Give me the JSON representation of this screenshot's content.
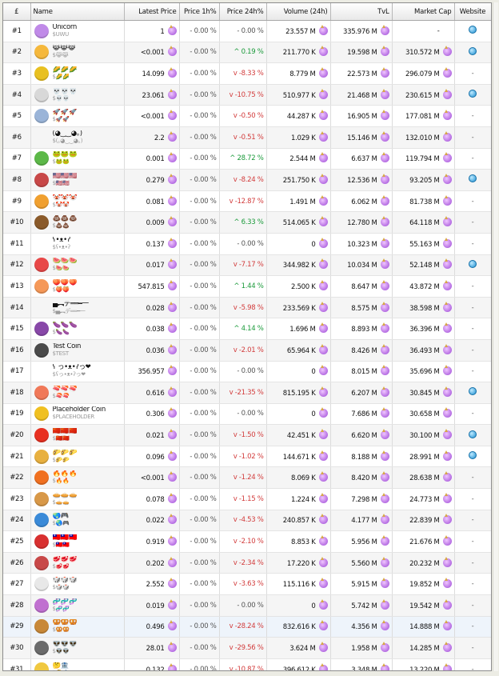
{
  "columns": [
    "£",
    "Name",
    "Latest Price",
    "Price 1h%",
    "Price 24h%",
    "Volume (24h)",
    "TvL",
    "Market Cap",
    "Website"
  ],
  "rows": [
    {
      "rank": "#1",
      "name": "Unicorn",
      "symbol": "$UWU",
      "price": "1",
      "h1": "- 0.00 %",
      "h24": "- 0.00 %",
      "h24dir": "flat",
      "volume": "23.557 M",
      "tvl": "335.976 M",
      "mcap": "-",
      "web": "globe",
      "color": "#c08ae8"
    },
    {
      "rank": "#2",
      "name": "😹😹😹",
      "symbol": "$😹😹",
      "price": "<0.001",
      "h1": "- 0.00 %",
      "h24": "^ 0.19 %",
      "h24dir": "up",
      "volume": "211.770 K",
      "tvl": "19.598 M",
      "mcap": "310.572 M",
      "web": "globe",
      "color": "#f5b83c"
    },
    {
      "rank": "#3",
      "name": "🌽🌽🌽",
      "symbol": "$🌽🌽",
      "price": "14.099",
      "h1": "- 0.00 %",
      "h24": "v -8.33 %",
      "h24dir": "down",
      "volume": "8.779 M",
      "tvl": "22.573 M",
      "mcap": "296.079 M",
      "web": "-",
      "color": "#e8c020"
    },
    {
      "rank": "#4",
      "name": "💀💀💀",
      "symbol": "$💀💀",
      "price": "23.061",
      "h1": "- 0.00 %",
      "h24": "v -10.75 %",
      "h24dir": "down",
      "volume": "510.977 K",
      "tvl": "21.468 M",
      "mcap": "230.615 M",
      "web": "globe",
      "color": "#d8d8d8"
    },
    {
      "rank": "#5",
      "name": "🚀🚀🚀",
      "symbol": "$🚀🚀",
      "price": "<0.001",
      "h1": "- 0.00 %",
      "h24": "v -0.50 %",
      "h24dir": "down",
      "volume": "44.287 K",
      "tvl": "16.905 M",
      "mcap": "177.081 M",
      "web": "-",
      "color": "#9ab4d8"
    },
    {
      "rank": "#6",
      "name": "(◕‿‿◕｡)",
      "symbol": "$(｡◕‿‿◕｡)",
      "price": "2.2",
      "h1": "- 0.00 %",
      "h24": "v -0.51 %",
      "h24dir": "down",
      "volume": "1.029 K",
      "tvl": "15.146 M",
      "mcap": "132.010 M",
      "web": "-",
      "color": "#ffffff"
    },
    {
      "rank": "#7",
      "name": "🐸🐸🐸",
      "symbol": "$🐸🐸",
      "price": "0.001",
      "h1": "- 0.00 %",
      "h24": "^ 28.72 %",
      "h24dir": "up",
      "volume": "2.544 M",
      "tvl": "6.637 M",
      "mcap": "119.794 M",
      "web": "-",
      "color": "#5cb848"
    },
    {
      "rank": "#8",
      "name": "🇺🇸🇺🇸🇺🇸",
      "symbol": "$🇺🇸🇺🇸",
      "price": "0.279",
      "h1": "- 0.00 %",
      "h24": "v -8.24 %",
      "h24dir": "down",
      "volume": "251.750 K",
      "tvl": "12.536 M",
      "mcap": "93.205 M",
      "web": "globe",
      "color": "#c84848"
    },
    {
      "rank": "#9",
      "name": "🤡🤡🤡",
      "symbol": "$🤡🤡",
      "price": "0.081",
      "h1": "- 0.00 %",
      "h24": "v -12.87 %",
      "h24dir": "down",
      "volume": "1.491 M",
      "tvl": "6.062 M",
      "mcap": "81.738 M",
      "web": "-",
      "color": "#f0a030"
    },
    {
      "rank": "#10",
      "name": "💩💩💩",
      "symbol": "$💩💩",
      "price": "0.009",
      "h1": "- 0.00 %",
      "h24": "^ 6.33 %",
      "h24dir": "up",
      "volume": "514.065 K",
      "tvl": "12.780 M",
      "mcap": "64.118 M",
      "web": "-",
      "color": "#8a5a2a"
    },
    {
      "rank": "#11",
      "name": "ʕ•ᴥ•ʔ",
      "symbol": "$ʕ•ᴥ•ʔ",
      "price": "0.137",
      "h1": "- 0.00 %",
      "h24": "- 0.00 %",
      "h24dir": "flat",
      "volume": "0",
      "tvl": "10.323 M",
      "mcap": "55.163 M",
      "web": "-",
      "color": "#ffffff"
    },
    {
      "rank": "#12",
      "name": "🍉🍉🍉",
      "symbol": "$🍉🍉",
      "price": "0.017",
      "h1": "- 0.00 %",
      "h24": "v -7.17 %",
      "h24dir": "down",
      "volume": "344.982 K",
      "tvl": "10.034 M",
      "mcap": "52.148 M",
      "web": "globe",
      "color": "#e84848"
    },
    {
      "rank": "#13",
      "name": "🍑🍑🍑",
      "symbol": "$🍑🍑",
      "price": "547.815",
      "h1": "- 0.00 %",
      "h24": "^ 1.44 %",
      "h24dir": "up",
      "volume": "2.500 K",
      "tvl": "8.647 M",
      "mcap": "43.872 M",
      "web": "-",
      "color": "#f59858"
    },
    {
      "rank": "#14",
      "name": "▄︻デ══━一",
      "symbol": "$▄︻デ══━一",
      "price": "0.028",
      "h1": "- 0.00 %",
      "h24": "v -5.98 %",
      "h24dir": "down",
      "volume": "233.569 K",
      "tvl": "8.575 M",
      "mcap": "38.598 M",
      "web": "-",
      "color": "#ffffff"
    },
    {
      "rank": "#15",
      "name": "🍆🍆🍆",
      "symbol": "$🍆🍆",
      "price": "0.038",
      "h1": "- 0.00 %",
      "h24": "^ 4.14 %",
      "h24dir": "up",
      "volume": "1.696 M",
      "tvl": "8.893 M",
      "mcap": "36.396 M",
      "web": "-",
      "color": "#8848a8"
    },
    {
      "rank": "#16",
      "name": "Test Coin",
      "symbol": "$TEST",
      "price": "0.036",
      "h1": "- 0.00 %",
      "h24": "v -2.01 %",
      "h24dir": "down",
      "volume": "65.964 K",
      "tvl": "8.426 M",
      "mcap": "36.493 M",
      "web": "-",
      "color": "#4a4a4a"
    },
    {
      "rank": "#17",
      "name": "ʕ っ•ᴥ•ʔっ❤",
      "symbol": "$ʕっ•ᴥ•ʔっ❤",
      "price": "356.957",
      "h1": "- 0.00 %",
      "h24": "- 0.00 %",
      "h24dir": "flat",
      "volume": "0",
      "tvl": "8.015 M",
      "mcap": "35.696 M",
      "web": "-",
      "color": "#ffffff"
    },
    {
      "rank": "#18",
      "name": "🍣🍣🍣",
      "symbol": "$🍣🍣",
      "price": "0.616",
      "h1": "- 0.00 %",
      "h24": "v -21.35 %",
      "h24dir": "down",
      "volume": "815.195 K",
      "tvl": "6.207 M",
      "mcap": "30.845 M",
      "web": "globe",
      "color": "#f07858"
    },
    {
      "rank": "#19",
      "name": "Placeholder Coin",
      "symbol": "$PLACEHOLDER",
      "price": "0.306",
      "h1": "- 0.00 %",
      "h24": "- 0.00 %",
      "h24dir": "flat",
      "volume": "0",
      "tvl": "7.686 M",
      "mcap": "30.658 M",
      "web": "-",
      "color": "#f0c020"
    },
    {
      "rank": "#20",
      "name": "🇨🇳🇨🇳🇨🇳",
      "symbol": "$🇨🇳🇨🇳",
      "price": "0.021",
      "h1": "- 0.00 %",
      "h24": "v -1.50 %",
      "h24dir": "down",
      "volume": "42.451 K",
      "tvl": "6.620 M",
      "mcap": "30.100 M",
      "web": "globe",
      "color": "#e83020"
    },
    {
      "rank": "#21",
      "name": "🌮🌮🌮",
      "symbol": "$🌮🌮",
      "price": "0.096",
      "h1": "- 0.00 %",
      "h24": "v -1.02 %",
      "h24dir": "down",
      "volume": "144.671 K",
      "tvl": "8.188 M",
      "mcap": "28.991 M",
      "web": "globe",
      "color": "#e8b040"
    },
    {
      "rank": "#22",
      "name": "🔥🔥🔥",
      "symbol": "$🔥🔥",
      "price": "<0.001",
      "h1": "- 0.00 %",
      "h24": "v -1.24 %",
      "h24dir": "down",
      "volume": "8.069 K",
      "tvl": "8.420 M",
      "mcap": "28.638 M",
      "web": "-",
      "color": "#f07020"
    },
    {
      "rank": "#23",
      "name": "🥧🥧🥧",
      "symbol": "$🥧🥧",
      "price": "0.078",
      "h1": "- 0.00 %",
      "h24": "v -1.15 %",
      "h24dir": "down",
      "volume": "1.224 K",
      "tvl": "7.298 M",
      "mcap": "24.773 M",
      "web": "-",
      "color": "#d89848"
    },
    {
      "rank": "#24",
      "name": "🌏🎮",
      "symbol": "$🌏🎮",
      "price": "0.022",
      "h1": "- 0.00 %",
      "h24": "v -4.53 %",
      "h24dir": "down",
      "volume": "240.857 K",
      "tvl": "4.177 M",
      "mcap": "22.839 M",
      "web": "-",
      "color": "#3a8ad8"
    },
    {
      "rank": "#25",
      "name": "🇹🇼🇹🇼🇹🇼",
      "symbol": "$🇹🇼🇹🇼",
      "price": "0.919",
      "h1": "- 0.00 %",
      "h24": "v -2.10 %",
      "h24dir": "down",
      "volume": "8.853 K",
      "tvl": "5.956 M",
      "mcap": "21.676 M",
      "web": "-",
      "color": "#d83030"
    },
    {
      "rank": "#26",
      "name": "🥩🥩🥩",
      "symbol": "$🥩🥩",
      "price": "0.202",
      "h1": "- 0.00 %",
      "h24": "v -2.34 %",
      "h24dir": "down",
      "volume": "17.220 K",
      "tvl": "5.560 M",
      "mcap": "20.232 M",
      "web": "-",
      "color": "#c84848"
    },
    {
      "rank": "#27",
      "name": "🎲🎲🎲",
      "symbol": "$🎲🎲",
      "price": "2.552",
      "h1": "- 0.00 %",
      "h24": "v -3.63 %",
      "h24dir": "down",
      "volume": "115.116 K",
      "tvl": "5.915 M",
      "mcap": "19.852 M",
      "web": "-",
      "color": "#e8e8e8"
    },
    {
      "rank": "#28",
      "name": "🧬🧬🧬",
      "symbol": "$🧬🧬",
      "price": "0.019",
      "h1": "- 0.00 %",
      "h24": "- 0.00 %",
      "h24dir": "flat",
      "volume": "0",
      "tvl": "5.742 M",
      "mcap": "19.542 M",
      "web": "-",
      "color": "#c070d0"
    },
    {
      "rank": "#29",
      "name": "🥨🥨🥨",
      "symbol": "$🥨🥨",
      "price": "0.496",
      "h1": "- 0.00 %",
      "h24": "v -28.24 %",
      "h24dir": "down",
      "volume": "832.616 K",
      "tvl": "4.356 M",
      "mcap": "14.888 M",
      "web": "-",
      "color": "#c88838"
    },
    {
      "rank": "#30",
      "name": "👽👽👽",
      "symbol": "$👽👽",
      "price": "28.01",
      "h1": "- 0.00 %",
      "h24": "v -29.56 %",
      "h24dir": "down",
      "volume": "3.624 M",
      "tvl": "1.958 M",
      "mcap": "14.285 M",
      "web": "-",
      "color": "#6a6a6a"
    },
    {
      "rank": "#31",
      "name": "🤔🏦",
      "symbol": "$🤔🏦",
      "price": "0.132",
      "h1": "- 0.00 %",
      "h24": "v -10.87 %",
      "h24dir": "down",
      "volume": "396.612 K",
      "tvl": "3.348 M",
      "mcap": "13.220 M",
      "web": "-",
      "color": "#f0c840"
    }
  ]
}
